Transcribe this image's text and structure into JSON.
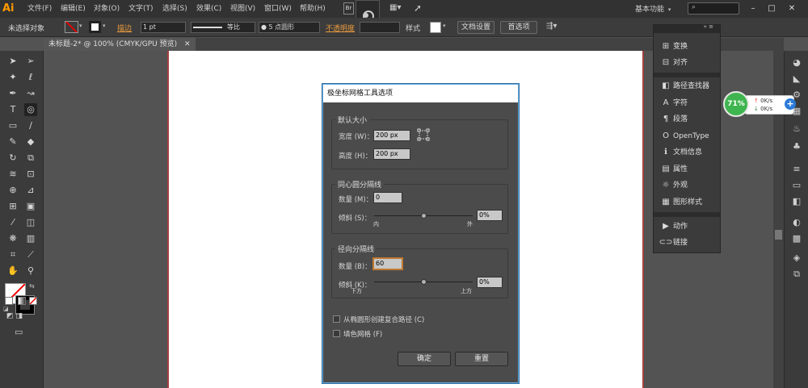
{
  "app": {
    "logo": "Ai"
  },
  "menu": [
    "文件(F)",
    "编辑(E)",
    "对象(O)",
    "文字(T)",
    "选择(S)",
    "效果(C)",
    "视图(V)",
    "窗口(W)",
    "帮助(H)"
  ],
  "menubar_extra": {
    "br_label": "Br",
    "workspace": "基本功能",
    "workspace_arrow": "▾"
  },
  "window_controls": {
    "minimize": "–",
    "maximize": "□",
    "close": "✕"
  },
  "control_bar": {
    "selection": "未选择对象",
    "stroke_label": "描边",
    "stroke_value": "1 pt",
    "profile": "等比",
    "brush": "5 点圆形",
    "opacity_label": "不透明度",
    "style_label": "样式",
    "doc_setup": "文档设置",
    "preferences": "首选项"
  },
  "document": {
    "tab_title": "未标题-2* @ 100% (CMYK/GPU 预览)",
    "close": "✕"
  },
  "dialog": {
    "title": "极坐标网格工具选项",
    "default_size": {
      "label": "默认大小",
      "width_label": "宽度 (W)：",
      "width_value": "200 px",
      "height_label": "高度 (H)：",
      "height_value": "200 px"
    },
    "concentric": {
      "label": "同心圆分隔线",
      "count_label": "数量 (M)：",
      "count_value": "0",
      "skew_label": "倾斜 (S)：",
      "skew_value": "0%",
      "skew_slider": 0.5,
      "left_tick": "内",
      "right_tick": "外"
    },
    "radial": {
      "label": "径向分隔线",
      "count_label": "数量 (B)：",
      "count_value": "60",
      "skew_label": "倾斜 (K)：",
      "skew_value": "0%",
      "skew_slider": 0.5,
      "left_tick": "下方",
      "right_tick": "上方"
    },
    "compound_path": "从椭圆形创建复合路径 (C)",
    "fill_grid": "填色网格 (F)",
    "ok": "确定",
    "reset": "重置"
  },
  "right_panel": {
    "items": [
      {
        "icon": "transform-icon",
        "glyph": "⊞",
        "label": "变换"
      },
      {
        "icon": "align-icon",
        "glyph": "⊟",
        "label": "对齐"
      },
      {
        "icon": "pathfinder-icon",
        "glyph": "◧",
        "label": "路径查找器"
      },
      {
        "icon": "character-icon",
        "glyph": "A",
        "label": "字符"
      },
      {
        "icon": "paragraph-icon",
        "glyph": "¶",
        "label": "段落"
      },
      {
        "icon": "opentype-icon",
        "glyph": "O",
        "label": "OpenType"
      },
      {
        "icon": "document-info-icon",
        "glyph": "ℹ",
        "label": "文档信息"
      },
      {
        "icon": "attributes-icon",
        "glyph": "▤",
        "label": "属性"
      },
      {
        "icon": "appearance-icon",
        "glyph": "☼",
        "label": "外观"
      },
      {
        "icon": "graphic-styles-icon",
        "glyph": "▦",
        "label": "图形样式"
      },
      {
        "icon": "actions-icon",
        "glyph": "▶",
        "label": "动作"
      },
      {
        "icon": "links-icon",
        "glyph": "⊂⊃",
        "label": "链接"
      }
    ]
  },
  "widget": {
    "percent": "71%",
    "up_speed": "0K/s",
    "down_speed": "0K/s",
    "plus": "+"
  },
  "colors": {
    "accent_orange": "#ff9a00",
    "dialog_border": "#6aa8d8",
    "widget_green": "#3fb54f"
  }
}
